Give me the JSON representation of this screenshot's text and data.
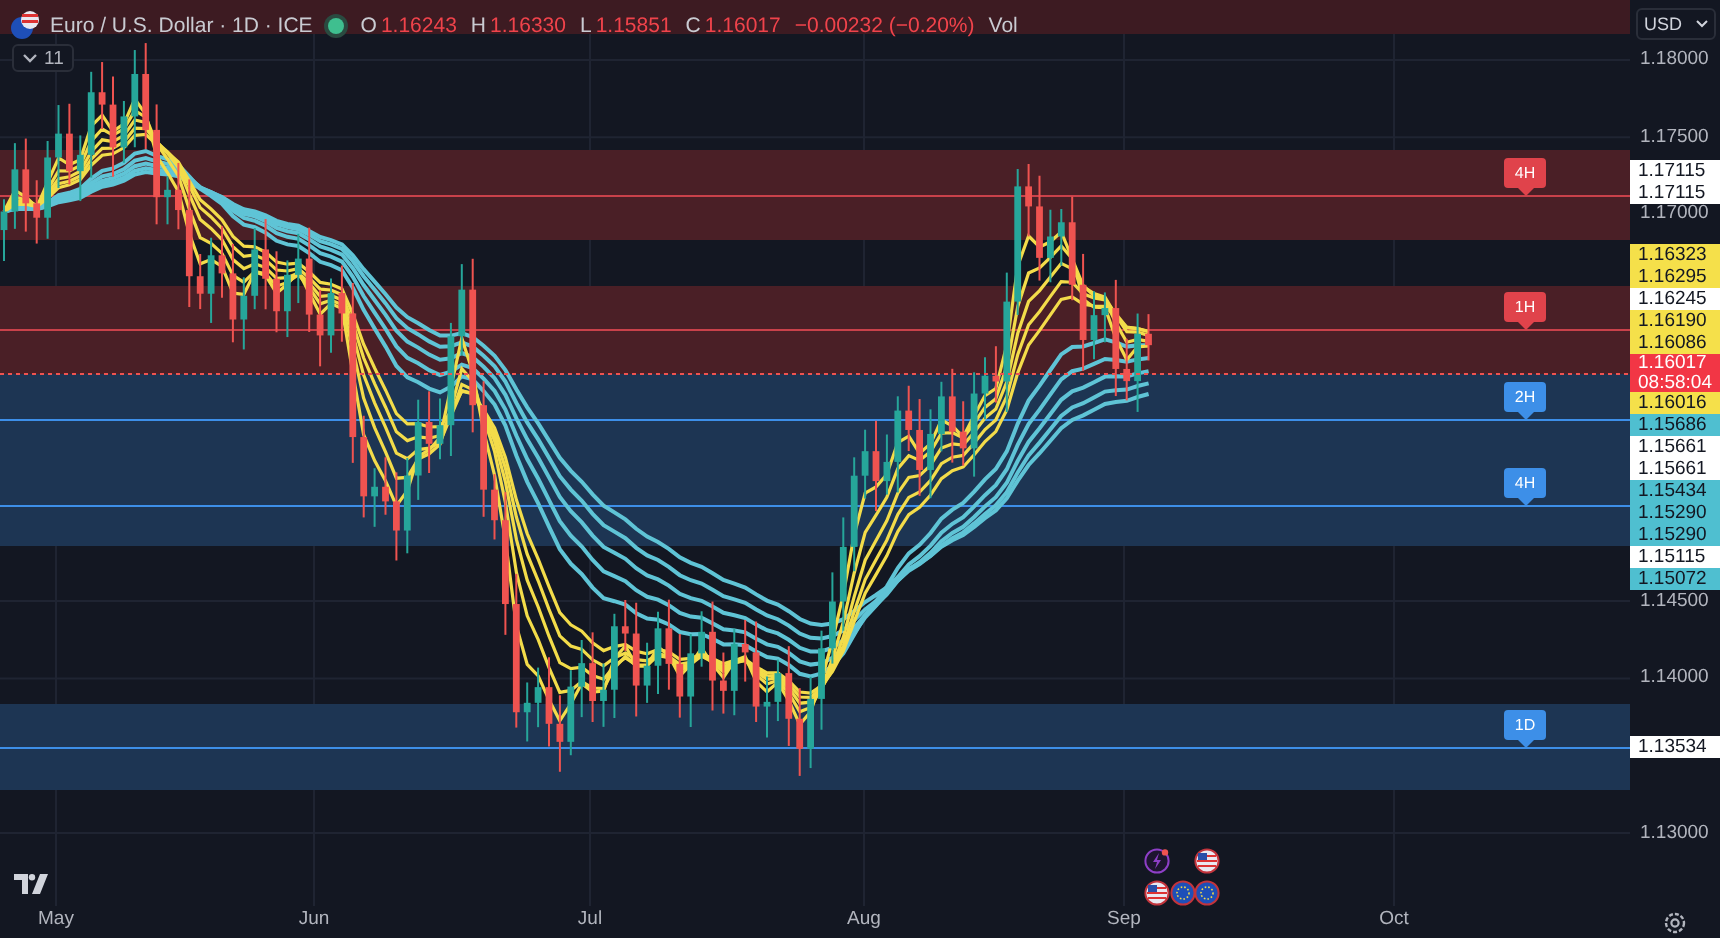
{
  "header": {
    "symbol": "Euro / U.S. Dollar · 1D · ICE",
    "market_open": true,
    "ohlc": [
      {
        "key": "O",
        "value": "1.16243"
      },
      {
        "key": "H",
        "value": "1.16330"
      },
      {
        "key": "L",
        "value": "1.15851"
      },
      {
        "key": "C",
        "value": "1.16017"
      }
    ],
    "change": "−0.00232 (−0.20%)",
    "volume_label": "Vol"
  },
  "indicators_toggle": {
    "count": "11"
  },
  "currency": "USD",
  "zones": [
    {
      "kind": "resistance",
      "tag": "4H"
    },
    {
      "kind": "resistance",
      "tag": "1H"
    },
    {
      "kind": "support",
      "tag": "2H"
    },
    {
      "kind": "support",
      "tag": "4H"
    },
    {
      "kind": "support",
      "tag": "1D"
    }
  ],
  "price_ticks": [
    "1.18000",
    "1.17500",
    "1.17000",
    "1.14500",
    "1.14000",
    "1.13000"
  ],
  "price_label_groups": [
    [
      {
        "kind": "level",
        "text": "1.17115"
      },
      {
        "kind": "level",
        "text": "1.17115"
      }
    ],
    [
      {
        "kind": "fast_ma",
        "text": "1.16323"
      },
      {
        "kind": "fast_ma",
        "text": "1.16295"
      },
      {
        "kind": "level",
        "text": "1.16245"
      },
      {
        "kind": "fast_ma",
        "text": "1.16190"
      },
      {
        "kind": "fast_ma",
        "text": "1.16086"
      },
      {
        "kind": "current",
        "text": "1.16017",
        "countdown": "08:58:04"
      },
      {
        "kind": "fast_ma",
        "text": "1.16016"
      },
      {
        "kind": "slow_ma",
        "text": "1.15686"
      },
      {
        "kind": "level",
        "text": "1.15661"
      },
      {
        "kind": "level",
        "text": "1.15661"
      },
      {
        "kind": "slow_ma",
        "text": "1.15434"
      },
      {
        "kind": "slow_ma",
        "text": "1.15290"
      },
      {
        "kind": "slow_ma",
        "text": "1.15290"
      },
      {
        "kind": "level",
        "text": "1.15115"
      },
      {
        "kind": "slow_ma",
        "text": "1.15072"
      }
    ],
    [
      {
        "kind": "level",
        "text": "1.13534"
      }
    ]
  ],
  "time_axis": [
    "May",
    "Jun",
    "Jul",
    "Aug",
    "Sep",
    "Oct"
  ]
}
